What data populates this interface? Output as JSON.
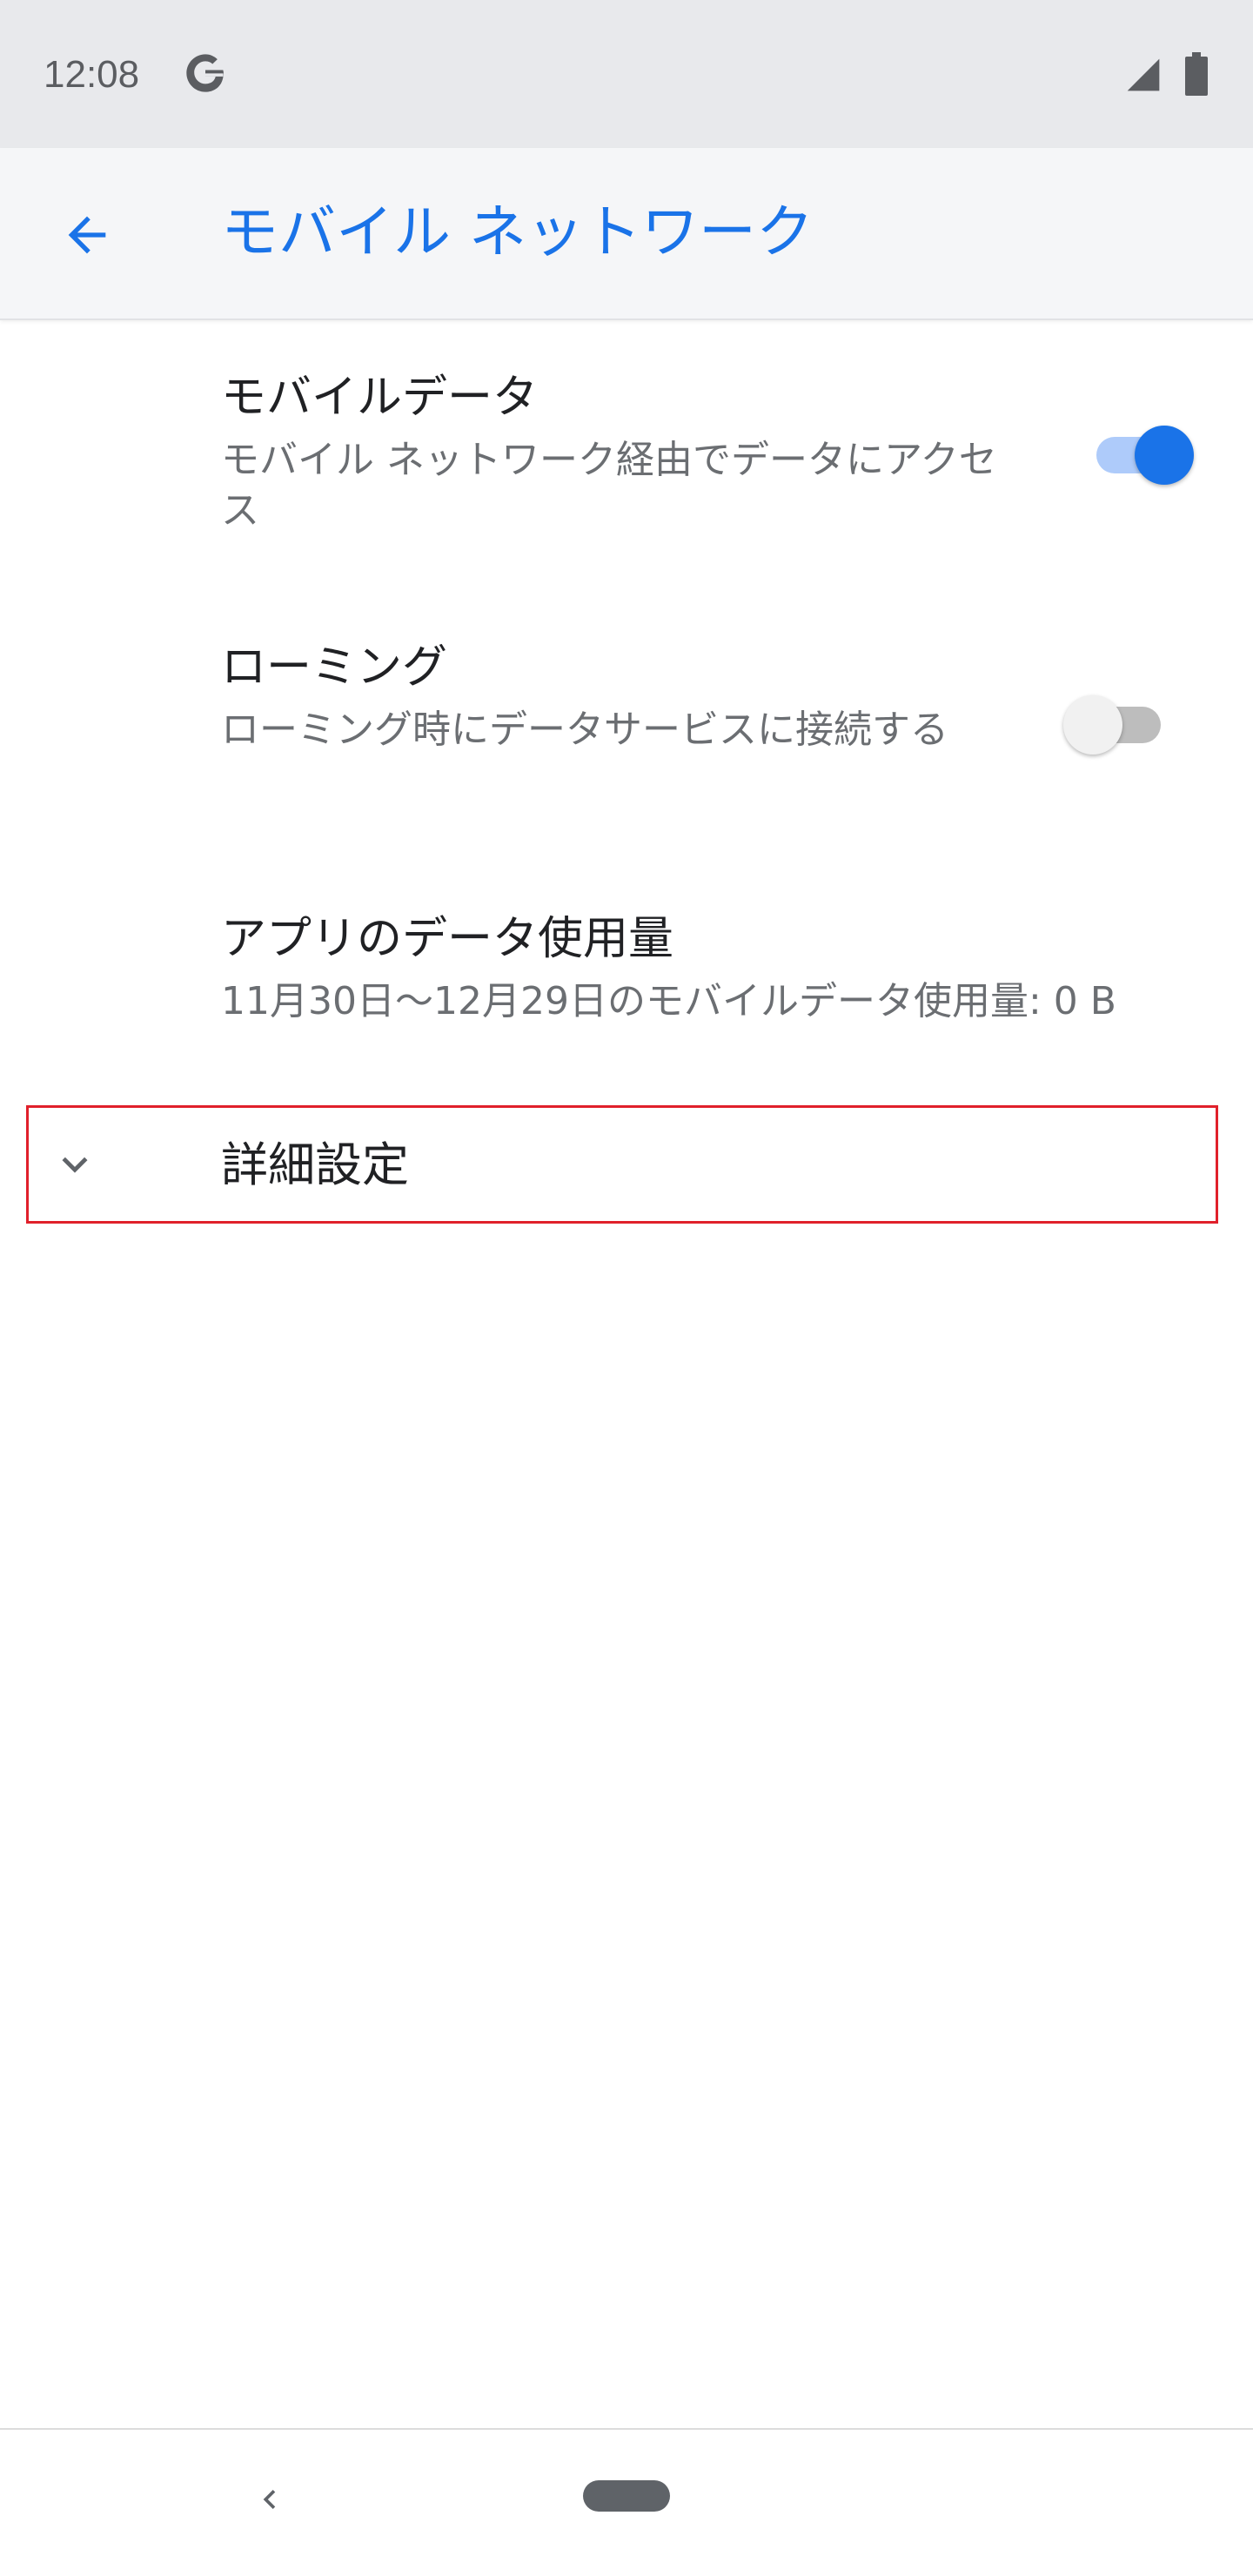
{
  "status_bar": {
    "time": "12:08",
    "icons": [
      "google-g-icon",
      "cell-signal-icon",
      "battery-icon"
    ]
  },
  "app_bar": {
    "title": "モバイル ネットワーク",
    "back_icon": "arrow-back-icon"
  },
  "settings": {
    "mobile_data": {
      "title": "モバイルデータ",
      "summary": "モバイル ネットワーク経由でデータにアクセス",
      "enabled": true
    },
    "roaming": {
      "title": "ローミング",
      "summary": "ローミング時にデータサービスに接続する",
      "enabled": false
    },
    "app_data_usage": {
      "title": "アプリのデータ使用量",
      "summary": "11月30日〜12月29日のモバイルデータ使用量: 0 B"
    },
    "advanced": {
      "label": "詳細設定",
      "icon": "chevron-down-icon"
    }
  },
  "nav_bar": {
    "back_icon": "nav-back-icon",
    "home_icon": "home-pill-icon"
  },
  "colors": {
    "accent": "#1a73e8",
    "highlight_border": "#e0202b",
    "status_bar_bg": "#e8e9ec",
    "app_bar_bg": "#f5f6f8"
  }
}
